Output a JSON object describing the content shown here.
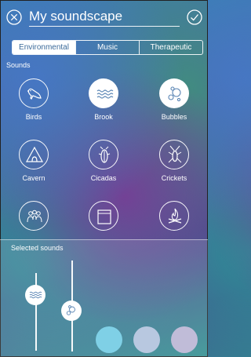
{
  "header": {
    "title": "My soundscape",
    "close_icon": "close-circle-icon",
    "confirm_icon": "check-circle-icon"
  },
  "tabs": [
    {
      "label": "Environmental",
      "active": true
    },
    {
      "label": "Music",
      "active": false
    },
    {
      "label": "Therapeutic",
      "active": false
    }
  ],
  "sounds_section": {
    "label": "Sounds",
    "items": [
      {
        "label": "Birds",
        "icon": "bird-icon",
        "selected": false
      },
      {
        "label": "Brook",
        "icon": "waves-icon",
        "selected": true
      },
      {
        "label": "Bubbles",
        "icon": "bubbles-icon",
        "selected": true
      },
      {
        "label": "Cavern",
        "icon": "cavern-icon",
        "selected": false
      },
      {
        "label": "Cicadas",
        "icon": "cicada-icon",
        "selected": false
      },
      {
        "label": "Crickets",
        "icon": "cricket-icon",
        "selected": false
      },
      {
        "label": "",
        "icon": "crowd-icon",
        "selected": false
      },
      {
        "label": "",
        "icon": "window-icon",
        "selected": false
      },
      {
        "label": "",
        "icon": "campfire-icon",
        "selected": false
      }
    ]
  },
  "selected_section": {
    "label": "Selected sounds",
    "mixers": [
      {
        "sound": "Brook",
        "icon": "waves-icon",
        "volume": 0.72
      },
      {
        "sound": "Bubbles",
        "icon": "bubbles-icon",
        "volume": 0.45
      }
    ],
    "empty_slots": [
      {
        "color": "#7fd0e6"
      },
      {
        "color": "#b8c8e0"
      },
      {
        "color": "#c0bcd8"
      }
    ]
  },
  "colors": {
    "accent": "#3b6a9a",
    "white": "#ffffff"
  }
}
